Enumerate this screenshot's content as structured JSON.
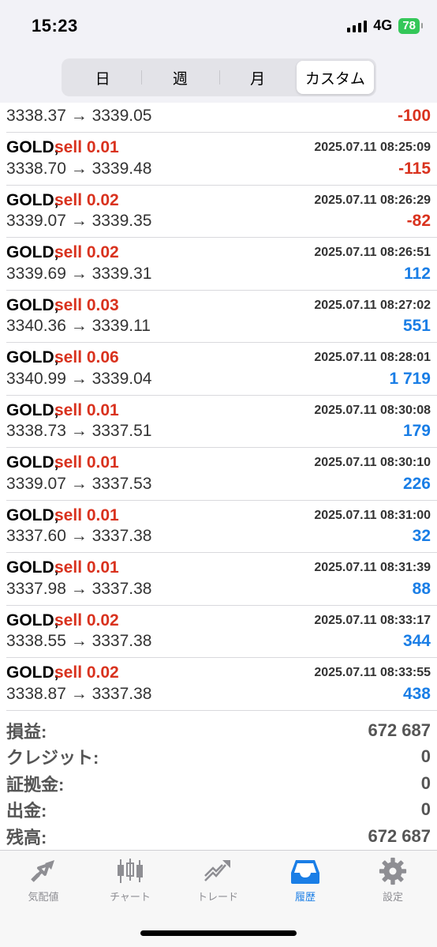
{
  "status": {
    "time": "15:23",
    "network": "4G",
    "battery": "78"
  },
  "period_tabs": [
    "日",
    "週",
    "月",
    "カスタム"
  ],
  "first_row": {
    "prices": "3338.37 → 3339.05",
    "profit": "-100"
  },
  "trades": [
    {
      "symbol": "GOLD,",
      "side": "sell 0.01",
      "time": "2025.07.11 08:25:09",
      "prices": "3338.70 → 3339.48",
      "profit": "-115"
    },
    {
      "symbol": "GOLD,",
      "side": "sell 0.02",
      "time": "2025.07.11 08:26:29",
      "prices": "3339.07 → 3339.35",
      "profit": "-82"
    },
    {
      "symbol": "GOLD,",
      "side": "sell 0.02",
      "time": "2025.07.11 08:26:51",
      "prices": "3339.69 → 3339.31",
      "profit": "112"
    },
    {
      "symbol": "GOLD,",
      "side": "sell 0.03",
      "time": "2025.07.11 08:27:02",
      "prices": "3340.36 → 3339.11",
      "profit": "551"
    },
    {
      "symbol": "GOLD,",
      "side": "sell 0.06",
      "time": "2025.07.11 08:28:01",
      "prices": "3340.99 → 3339.04",
      "profit": "1 719"
    },
    {
      "symbol": "GOLD,",
      "side": "sell 0.01",
      "time": "2025.07.11 08:30:08",
      "prices": "3338.73 → 3337.51",
      "profit": "179"
    },
    {
      "symbol": "GOLD,",
      "side": "sell 0.01",
      "time": "2025.07.11 08:30:10",
      "prices": "3339.07 → 3337.53",
      "profit": "226"
    },
    {
      "symbol": "GOLD,",
      "side": "sell 0.01",
      "time": "2025.07.11 08:31:00",
      "prices": "3337.60 → 3337.38",
      "profit": "32"
    },
    {
      "symbol": "GOLD,",
      "side": "sell 0.01",
      "time": "2025.07.11 08:31:39",
      "prices": "3337.98 → 3337.38",
      "profit": "88"
    },
    {
      "symbol": "GOLD,",
      "side": "sell 0.02",
      "time": "2025.07.11 08:33:17",
      "prices": "3338.55 → 3337.38",
      "profit": "344"
    },
    {
      "symbol": "GOLD,",
      "side": "sell 0.02",
      "time": "2025.07.11 08:33:55",
      "prices": "3338.87 → 3337.38",
      "profit": "438"
    }
  ],
  "summary": [
    {
      "label": "損益:",
      "value": "672 687"
    },
    {
      "label": "クレジット:",
      "value": "0"
    },
    {
      "label": "証拠金:",
      "value": "0"
    },
    {
      "label": "出金:",
      "value": "0"
    },
    {
      "label": "残高:",
      "value": "672 687"
    }
  ],
  "tabbar": [
    {
      "label": "気配値",
      "icon": "quotes-icon"
    },
    {
      "label": "チャート",
      "icon": "chart-icon"
    },
    {
      "label": "トレード",
      "icon": "trade-icon"
    },
    {
      "label": "履歴",
      "icon": "history-icon",
      "active": true
    },
    {
      "label": "設定",
      "icon": "settings-icon"
    }
  ],
  "colors": {
    "loss": "#d9321e",
    "profit": "#1a7ee6",
    "sell": "#d9321e",
    "active_tab": "#1a7ee6"
  }
}
